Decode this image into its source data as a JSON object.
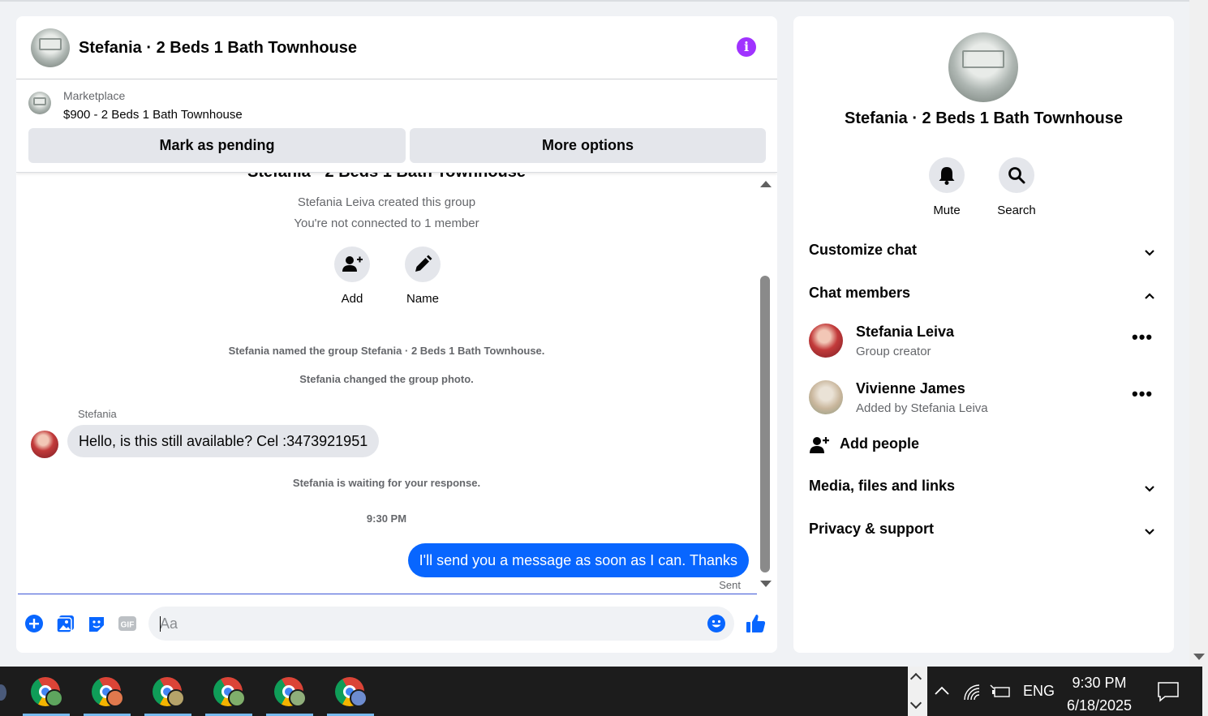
{
  "chat": {
    "title": "Stefania · 2 Beds 1 Bath Townhouse",
    "listing": {
      "label": "Marketplace",
      "price_title": "$900 - 2 Beds 1 Bath Townhouse",
      "btn_pending": "Mark as pending",
      "btn_more": "More options"
    },
    "messages": {
      "group_title": "Stefania · 2 Beds 1 Bath Townhouse",
      "created": "Stefania Leiva created this group",
      "not_connected": "You're not connected to 1 member",
      "add_label": "Add",
      "name_label": "Name",
      "named_event": "Stefania named the group Stefania · 2 Beds 1 Bath Townhouse.",
      "photo_event": "Stefania changed the group photo.",
      "sender": "Stefania",
      "incoming_text": "Hello, is this still available? Cel :3473921951",
      "waiting": "Stefania is waiting for your response.",
      "timestamp": "9:30 PM",
      "outgoing_text": "I'll send you a message as soon as I can. Thanks",
      "status": "Sent"
    },
    "composer": {
      "placeholder": "Aa",
      "gif_label": "GIF"
    }
  },
  "side": {
    "title": "Stefania · 2 Beds 1 Bath Townhouse",
    "mute_label": "Mute",
    "search_label": "Search",
    "sections": {
      "customize": "Customize chat",
      "members": "Chat members",
      "media": "Media, files and links",
      "privacy": "Privacy & support"
    },
    "members": [
      {
        "name": "Stefania Leiva",
        "role": "Group creator"
      },
      {
        "name": "Vivienne James",
        "role": "Added by Stefania Leiva"
      }
    ],
    "add_people": "Add people"
  },
  "taskbar": {
    "apps": [
      {
        "name": "chrome",
        "badge_color": "#5ea55e"
      },
      {
        "name": "chrome",
        "badge_color": "#e0794d"
      },
      {
        "name": "chrome",
        "badge_color": "#b5a36a"
      },
      {
        "name": "chrome",
        "badge_color": "#7fae6b"
      },
      {
        "name": "chrome",
        "badge_color": "#8fae7b"
      },
      {
        "name": "chrome",
        "badge_color": "#6d8ccf"
      }
    ],
    "language": "ENG",
    "time": "9:30 PM",
    "date": "6/18/2025"
  },
  "colors": {
    "accent_blue": "#0866ff",
    "info_purple": "#a033ff"
  }
}
